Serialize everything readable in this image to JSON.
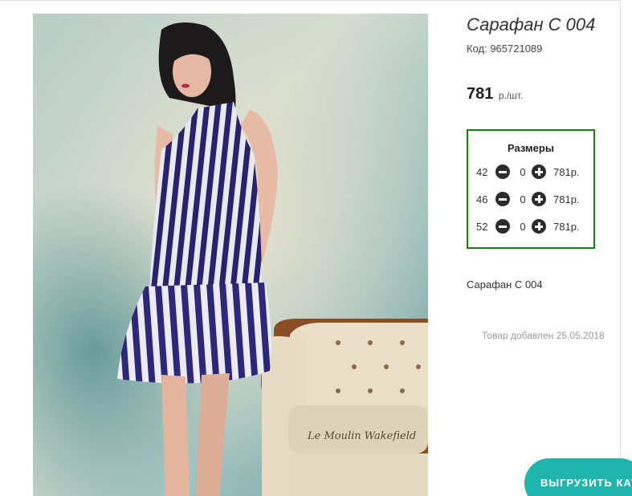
{
  "product": {
    "title": "Сарафан С 004",
    "code": "Код: 965721089",
    "price_value": "781",
    "price_unit": "р./шт.",
    "photo_icon": "product-photo",
    "description": "Сарафан С 004",
    "added": "Товар добавлен 25.05.2018"
  },
  "sizes": {
    "title": "Размеры",
    "rows": [
      {
        "size": "42",
        "qty": "0",
        "price": "781р."
      },
      {
        "size": "46",
        "qty": "0",
        "price": "781р."
      },
      {
        "size": "52",
        "qty": "0",
        "price": "781р."
      }
    ],
    "minus_icon": "minus-circle-icon",
    "plus_icon": "plus-circle-icon"
  },
  "actions": {
    "export_label": "ВЫГРУЗИТЬ КАТАЛОГ"
  },
  "colors": {
    "sizes_border": "#128012",
    "export_button": "#1fb5ac"
  }
}
